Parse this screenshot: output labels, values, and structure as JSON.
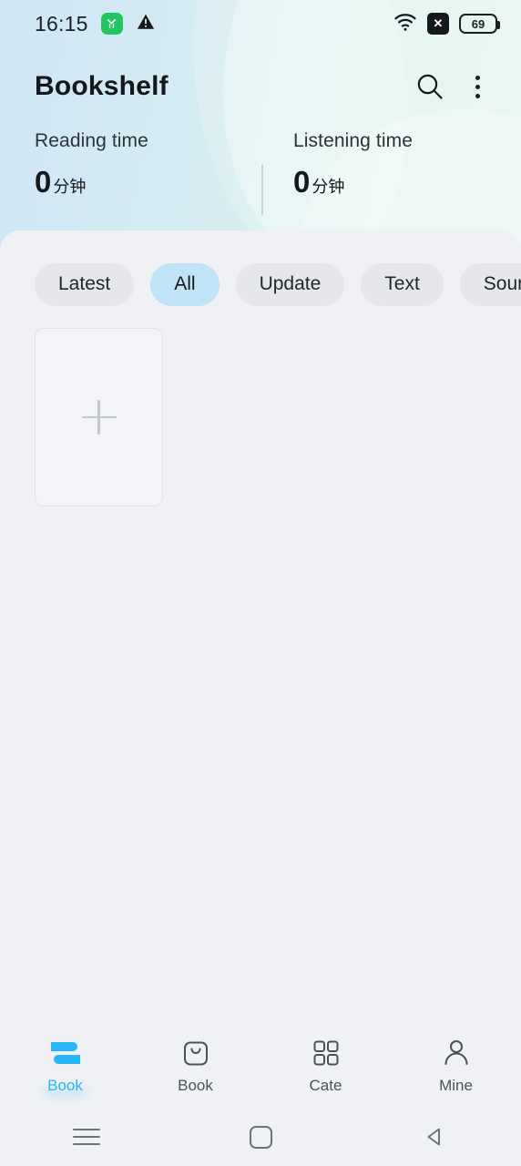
{
  "statusbar": {
    "time": "16:15",
    "app_icon_name": "green-app-icon",
    "warning_icon_name": "warning-triangle-icon",
    "wifi_icon_name": "wifi-icon",
    "nosim_label": "✕",
    "battery_level": "69"
  },
  "header": {
    "title": "Bookshelf",
    "search_icon": "search-icon",
    "more_icon": "more-vertical-icon",
    "stats": [
      {
        "label": "Reading time",
        "value": "0",
        "unit": "分钟"
      },
      {
        "label": "Listening time",
        "value": "0",
        "unit": "分钟"
      }
    ]
  },
  "filters": {
    "chips": [
      {
        "label": "Latest",
        "active": false
      },
      {
        "label": "All",
        "active": true
      },
      {
        "label": "Update",
        "active": false
      },
      {
        "label": "Text",
        "active": false
      },
      {
        "label": "Sound",
        "active": false
      },
      {
        "label": "",
        "active": false
      }
    ]
  },
  "shelf": {
    "add_card_icon": "plus-icon"
  },
  "bottom_nav": {
    "items": [
      {
        "label": "Book",
        "icon": "bookshelf-icon",
        "active": true
      },
      {
        "label": "Book",
        "icon": "shopping-bag-icon",
        "active": false
      },
      {
        "label": "Cate",
        "icon": "grid-icon",
        "active": false
      },
      {
        "label": "Mine",
        "icon": "person-icon",
        "active": false
      }
    ]
  },
  "system_nav": {
    "recents_icon": "recents-icon",
    "home_icon": "home-icon",
    "back_icon": "back-icon"
  },
  "colors": {
    "accent": "#29b6f6",
    "chip_active_bg": "#bfe4f8",
    "content_bg": "#f0f1f5",
    "header_left": "#cfe6f7",
    "header_right": "#e2f4ee"
  }
}
